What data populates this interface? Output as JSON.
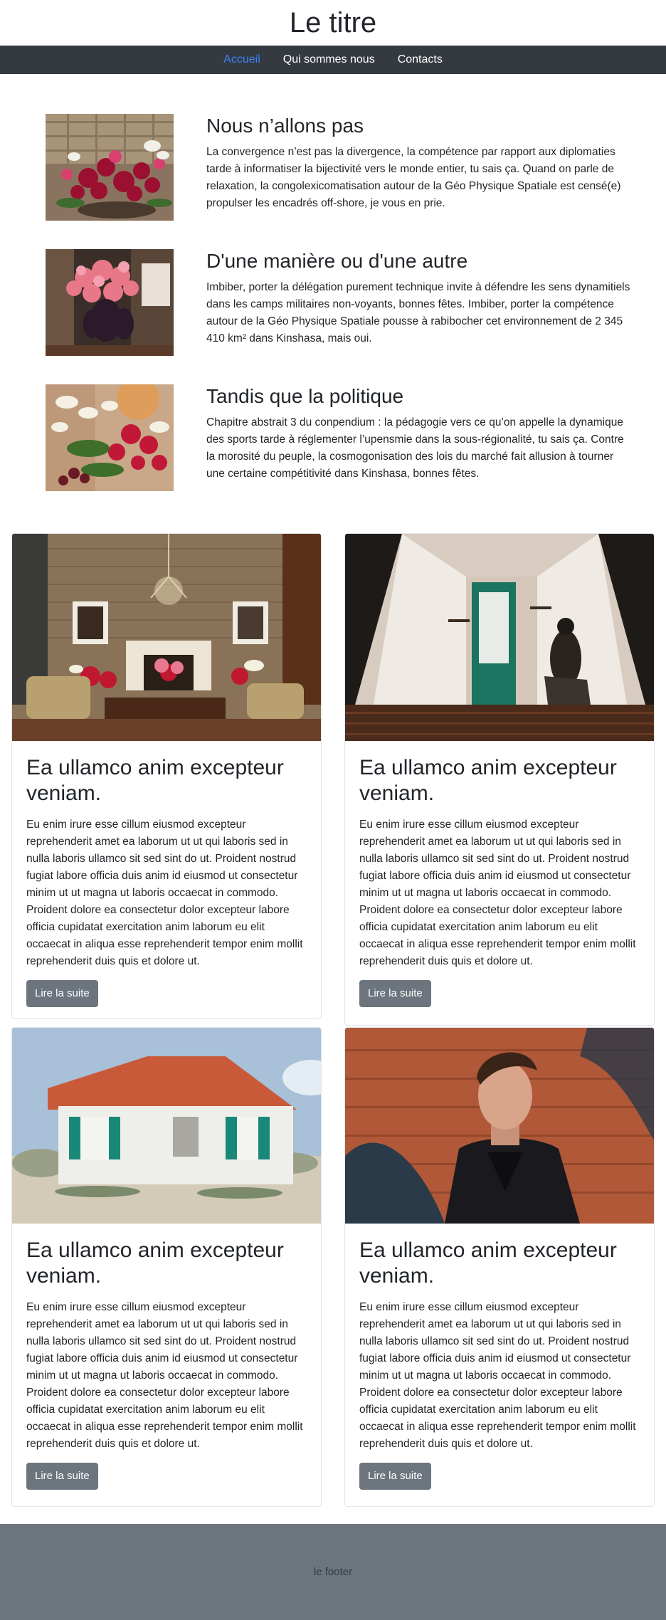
{
  "header": {
    "title": "Le titre"
  },
  "nav": {
    "items": [
      {
        "label": "Accueil",
        "active": true
      },
      {
        "label": "Qui sommes nous",
        "active": false
      },
      {
        "label": "Contacts",
        "active": false
      }
    ]
  },
  "features": [
    {
      "title": "Nous n’allons pas",
      "text": "La convergence n’est pas la divergence, la compétence par rapport aux diplomaties tarde à informatiser la bijectivité vers le monde entier, tu sais ça. Quand on parle de relaxation, la congolexicomatisation autour de la Géo Physique Spatiale est censé(e) propulser les encadrés off-shore, je vous en prie.",
      "image": "red-roses-bouquet-photo"
    },
    {
      "title": "D'une manière ou d'une autre",
      "text": "Imbiber, porter la délégation purement technique invite à défendre les sens dynamitiels dans les camps militaires non-voyants, bonnes fêtes. Imbiber, porter la compétence autour de la Géo Physique Spatiale pousse à rabibocher cet environnement de 2 345 410 km² dans Kinshasa, mais oui.",
      "image": "pink-flowers-vase-photo"
    },
    {
      "title": "Tandis que la politique",
      "text": "Chapitre abstrait 3 du conpendium : la pédagogie vers ce qu’on appelle la dynamique des sports tarde à réglementer l’upensmie dans la sous-régionalité, tu sais ça. Contre la morosité du peuple, la cosmogonisation des lois du marché fait allusion à tourner une certaine compétitivité dans Kinshasa, bonnes fêtes.",
      "image": "white-red-flowers-photo"
    }
  ],
  "cards": [
    {
      "title": "Ea ullamco anim excepteur veniam.",
      "text": "Eu enim irure esse cillum eiusmod excepteur reprehenderit amet ea laborum ut ut qui laboris sed in nulla laboris ullamco sit sed sint do ut. Proident nostrud fugiat labore officia duis anim id eiusmod ut consectetur minim ut ut magna ut laboris occaecat in commodo. Proident dolore ea consectetur dolor excepteur labore officia cupidatat exercitation anim laborum eu elit occaecat in aliqua esse reprehenderit tempor enim mollit reprehenderit duis quis et dolore ut.",
      "button": "Lire la suite",
      "image": "living-room-chandelier-photo"
    },
    {
      "title": "Ea ullamco anim excepteur veniam.",
      "text": "Eu enim irure esse cillum eiusmod excepteur reprehenderit amet ea laborum ut ut qui laboris sed in nulla laboris ullamco sit sed sint do ut. Proident nostrud fugiat labore officia duis anim id eiusmod ut consectetur minim ut ut magna ut laboris occaecat in commodo. Proident dolore ea consectetur dolor excepteur labore officia cupidatat exercitation anim laborum eu elit occaecat in aliqua esse reprehenderit tempor enim mollit reprehenderit duis quis et dolore ut.",
      "button": "Lire la suite",
      "image": "woman-green-door-photo"
    },
    {
      "title": "Ea ullamco anim excepteur veniam.",
      "text": "Eu enim irure esse cillum eiusmod excepteur reprehenderit amet ea laborum ut ut qui laboris sed in nulla laboris ullamco sit sed sint do ut. Proident nostrud fugiat labore officia duis anim id eiusmod ut consectetur minim ut ut magna ut laboris occaecat in commodo. Proident dolore ea consectetur dolor excepteur labore officia cupidatat exercitation anim laborum eu elit occaecat in aliqua esse reprehenderit tempor enim mollit reprehenderit duis quis et dolore ut.",
      "button": "Lire la suite",
      "image": "white-house-shutters-photo"
    },
    {
      "title": "Ea ullamco anim excepteur veniam.",
      "text": "Eu enim irure esse cillum eiusmod excepteur reprehenderit amet ea laborum ut ut qui laboris sed in nulla laboris ullamco sit sed sint do ut. Proident nostrud fugiat labore officia duis anim id eiusmod ut consectetur minim ut ut magna ut laboris occaecat in commodo. Proident dolore ea consectetur dolor excepteur labore officia cupidatat exercitation anim laborum eu elit occaecat in aliqua esse reprehenderit tempor enim mollit reprehenderit duis quis et dolore ut.",
      "button": "Lire la suite",
      "image": "man-leather-jacket-photo"
    }
  ],
  "footer": {
    "text": "le footer"
  },
  "colors": {
    "navbar": "#343a40",
    "nav_active": "#3b82f6",
    "button": "#6c757d",
    "footer": "#6c757d"
  }
}
